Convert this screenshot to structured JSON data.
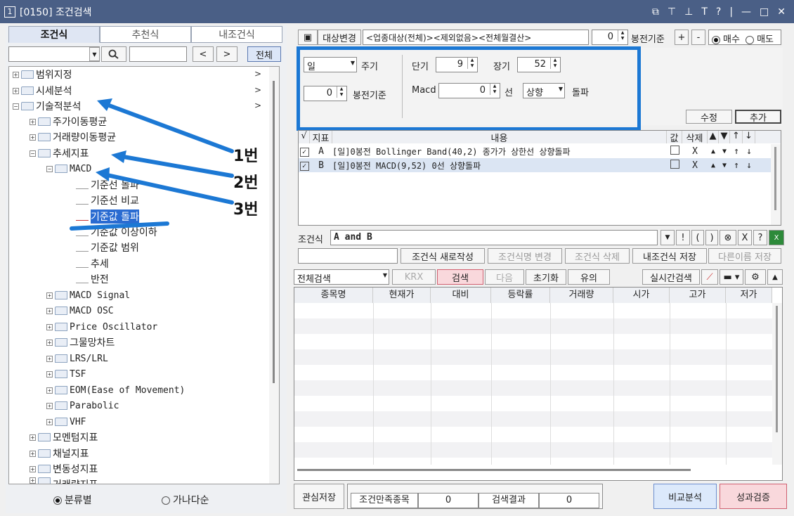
{
  "window": {
    "num": "1",
    "title": "[0150] 조건검색",
    "ctrls": [
      "⧉",
      "⊤",
      "⊥",
      "T",
      "?",
      "|",
      "—",
      "□",
      "✕"
    ]
  },
  "left": {
    "tabs": [
      "조건식",
      "추천식",
      "내조건식"
    ],
    "nav_prev": "<",
    "nav_next": ">",
    "all_button": "전체",
    "tree": [
      {
        "label": "범위지정",
        "arrow": ">"
      },
      {
        "label": "시세분석",
        "arrow": ">"
      },
      {
        "label": "기술적분석",
        "arrow": ">"
      },
      {
        "label": "주가이동평균"
      },
      {
        "label": "거래량이동평균"
      },
      {
        "label": "추세지표"
      },
      {
        "label": "MACD"
      },
      {
        "label": "기준선 돌파"
      },
      {
        "label": "기준선 비교"
      },
      {
        "label": "기준값 돌파"
      },
      {
        "label": "기준값 이상이하"
      },
      {
        "label": "기준값 범위"
      },
      {
        "label": "추세"
      },
      {
        "label": "반전"
      },
      {
        "label": "MACD Signal"
      },
      {
        "label": "MACD OSC"
      },
      {
        "label": "Price Oscillator"
      },
      {
        "label": "그물망차트"
      },
      {
        "label": "LRS/LRL"
      },
      {
        "label": "TSF"
      },
      {
        "label": "EOM(Ease of Movement)"
      },
      {
        "label": "Parabolic"
      },
      {
        "label": "VHF"
      },
      {
        "label": "모멘텀지표"
      },
      {
        "label": "채널지표"
      },
      {
        "label": "변동성지표"
      },
      {
        "label": "거래량지표"
      }
    ],
    "radio_category": "분류별",
    "radio_alpha": "가나다순"
  },
  "annotations": [
    "1번",
    "2번",
    "3번"
  ],
  "right": {
    "target_change": "대상변경",
    "target_text": "<업종대상(전체)><제외없음><전체월결산>",
    "bong_value": "0",
    "bong_label": "봉전기준",
    "plus": "+",
    "minus": "-",
    "buy": "매수",
    "sell": "매도",
    "period_select": "일",
    "period_label": "주기",
    "bong2_value": "0",
    "bong2_label": "봉전기준",
    "short_label": "단기",
    "short_value": "9",
    "long_label": "장기",
    "long_value": "52",
    "macd_label": "Macd",
    "macd_value": "0",
    "line_label": "선",
    "direction_select": "상향",
    "breakout_label": "돌파",
    "edit_btn": "수정",
    "add_btn": "추가",
    "cond_headers": [
      "√",
      "지표",
      "내용",
      "값",
      "삭제",
      "▲",
      "▼",
      "↑",
      "↓"
    ],
    "cond_rows": [
      {
        "key": "A",
        "content": "[일]0봉전 Bollinger Band(40,2) 종가가 상한선 상향돌파",
        "del": "X",
        "ops": [
          "▲",
          "▼",
          "↑",
          "↓"
        ]
      },
      {
        "key": "B",
        "content": "[일]0봉전 MACD(9,52) 0선 상향돌파",
        "del": "X",
        "ops": [
          "▲",
          "▼",
          "↑",
          "↓"
        ]
      }
    ],
    "formula_label": "조건식",
    "formula": "A and B",
    "formula_btns": [
      "▼",
      "!",
      "(",
      ")",
      "⊗",
      "X",
      "?"
    ],
    "new_btn": "조건식 새로작성",
    "rename_btn": "조건식명 변경",
    "delete_btn": "조건식 삭제",
    "save_btn": "내조건식 저장",
    "saveas_btn": "다른이름 저장",
    "search_scope": "전체검색",
    "krx": "KRX",
    "search_btn": "검색",
    "next_btn": "다음",
    "reset_btn": "초기화",
    "note_btn": "유의",
    "realtime_btn": "실시간검색",
    "result_headers": [
      "종목명",
      "현재가",
      "대비",
      "등락률",
      "거래량",
      "시가",
      "고가",
      "저가"
    ],
    "interest_save": "관심저장",
    "matched_label": "조건만족종목",
    "matched_value": "0",
    "result_label": "검색결과",
    "result_value": "0",
    "compare_btn": "비교분석",
    "verify_btn": "성과검증"
  },
  "colors": {
    "title_bar": "#4a5f86",
    "highlight": "#1c78d4",
    "selection": "#2a6bd1"
  }
}
